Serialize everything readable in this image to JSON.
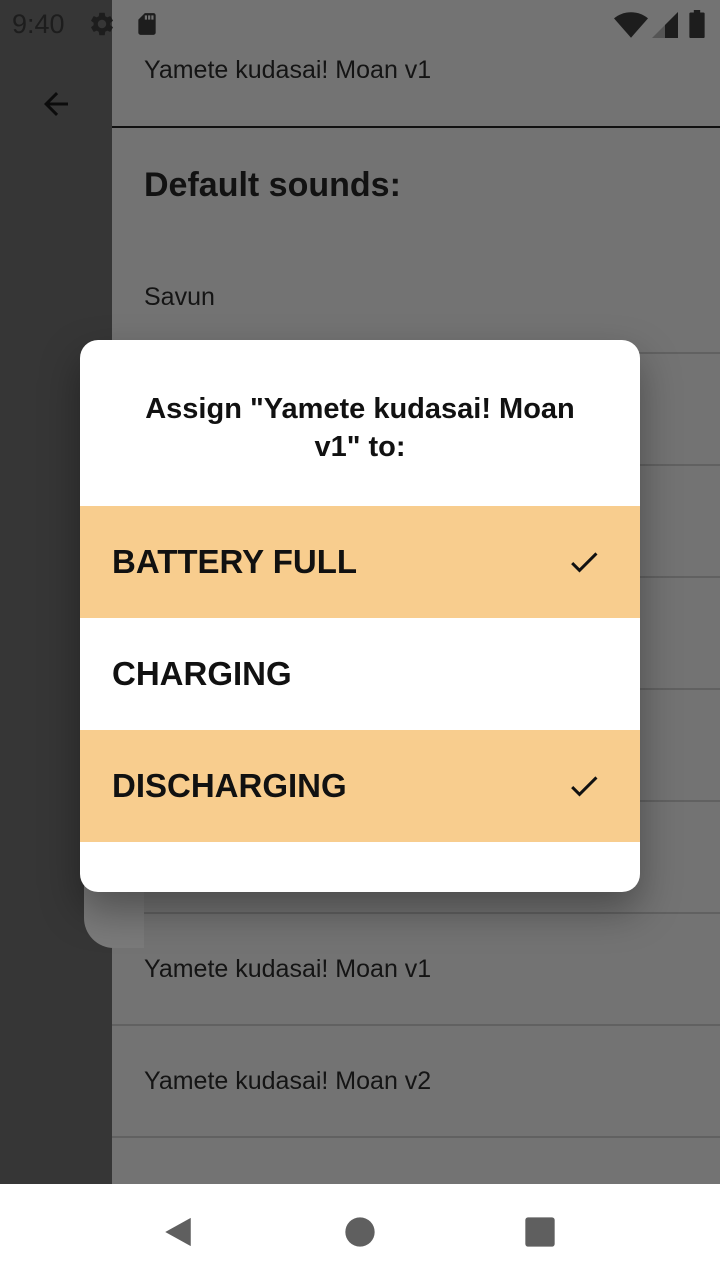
{
  "status_bar": {
    "time": "9:40",
    "icons": [
      "gear-icon",
      "sd-card-icon",
      "wifi-icon",
      "signal-icon",
      "battery-icon"
    ]
  },
  "colors": {
    "selected_option_bg": "#f8cd8e",
    "dim_panel": "#737373",
    "dim_strip": "#363636"
  },
  "background": {
    "top_item": "Yamete kudasai! Moan v1",
    "section_heading": "Default sounds:",
    "items": [
      "Savun",
      "Yamete kudasai! Moan v1",
      "Yamete kudasai! Moan v2"
    ]
  },
  "dialog": {
    "title": "Assign \"Yamete kudasai! Moan v1\" to:",
    "options": [
      {
        "label": "BATTERY FULL",
        "selected": true
      },
      {
        "label": "CHARGING",
        "selected": false
      },
      {
        "label": "DISCHARGING",
        "selected": true
      }
    ]
  },
  "nav": {
    "buttons": [
      "back-icon",
      "home-icon",
      "recents-icon"
    ]
  }
}
